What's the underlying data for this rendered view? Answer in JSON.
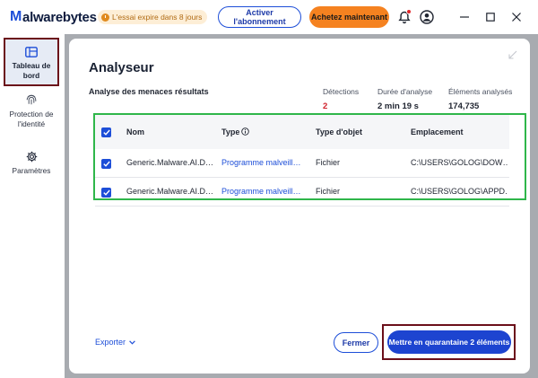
{
  "app": {
    "logo_m": "M",
    "logo_rest": "alwarebytes",
    "trial_text": "L'essai expire dans 8 jours",
    "subscribe_label": "Activer l'abonnement",
    "buy_label": "Achetez maintenant",
    "icons": {
      "trial": "clock-icon",
      "notifications": "bell-icon",
      "account": "account-icon",
      "minimize": "minimize-icon",
      "maximize": "maximize-icon",
      "close": "close-icon"
    }
  },
  "sidebar": {
    "items": [
      {
        "label": "Tableau de bord",
        "icon": "dashboard-icon",
        "active": true
      },
      {
        "label": "Protection de l'identité",
        "icon": "fingerprint-icon",
        "active": false
      },
      {
        "label": "Paramètres",
        "icon": "gear-icon",
        "active": false
      }
    ]
  },
  "scanner": {
    "title": "Analyseur",
    "subtitle": "Analyse des menaces résultats",
    "stats": {
      "detections_label": "Détections",
      "detections_value": "2",
      "duration_label": "Durée d'analyse",
      "duration_value": "2 min 19 s",
      "scanned_label": "Éléments analysés",
      "scanned_value": "174,735"
    },
    "table": {
      "columns": [
        "Nom",
        "Type",
        "Type d'objet",
        "Emplacement"
      ],
      "rows": [
        {
          "checked": true,
          "name": "Generic.Malware.AI.D…",
          "type": "Programme malveill…",
          "object_type": "Fichier",
          "location": "C:\\USERS\\GOLOG\\DOW…"
        },
        {
          "checked": true,
          "name": "Generic.Malware.AI.D…",
          "type": "Programme malveill…",
          "object_type": "Fichier",
          "location": "C:\\USERS\\GOLOG\\APPD…"
        }
      ]
    },
    "footer": {
      "export_label": "Exporter",
      "close_label": "Fermer",
      "quarantine_label": "Mettre en quarantaine 2 éléments"
    }
  },
  "colors": {
    "brand_blue": "#1d4ed8",
    "buy_orange": "#f58220",
    "detections_red": "#d0202b",
    "highlight_green": "#2fb64a",
    "highlight_maroon": "#6b0f1a"
  }
}
